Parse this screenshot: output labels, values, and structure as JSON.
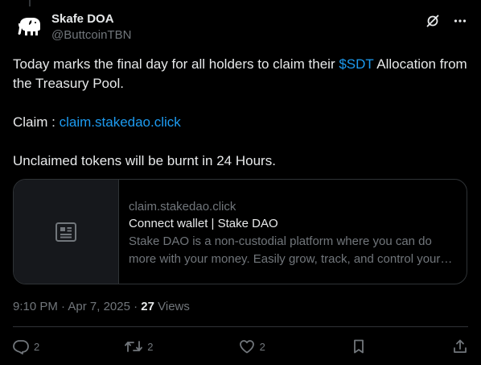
{
  "tweet": {
    "author": {
      "display_name": "Skafe DOA",
      "handle": "@ButtcoinTBN",
      "avatar_icon": "elephant-icon"
    },
    "header_icons": [
      "grok-icon",
      "more-icon"
    ],
    "body": {
      "line1_pre": "Today marks the final day for all holders to claim their ",
      "cashtag": "$SDT",
      "line1_post": " Allocation from the Treasury Pool.",
      "claim_label": "Claim : ",
      "claim_link": "claim.stakedao.click",
      "line3": "Unclaimed tokens will be burnt in 24 Hours."
    },
    "card": {
      "thumbnail_icon": "article-icon",
      "domain": "claim.stakedao.click",
      "title": "Connect wallet | Stake DAO",
      "description": "Stake DAO is a non-custodial platform where you can do more with your money. Easily grow, track, and control your assets right at your fingertips."
    },
    "meta": {
      "time": "9:10 PM",
      "separator": " · ",
      "date": "Apr 7, 2025",
      "views_count": "27",
      "views_label": " Views"
    },
    "actions": {
      "replies": "2",
      "reposts": "2",
      "likes": "2"
    },
    "colors": {
      "background": "#000000",
      "text": "#e7e9ea",
      "secondary": "#71767b",
      "link": "#1d9bf0",
      "border": "#2f3336"
    }
  }
}
